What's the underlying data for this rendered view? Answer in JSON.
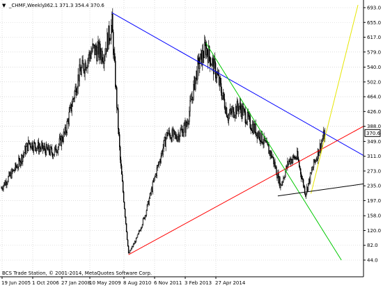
{
  "window": {
    "menu_glyph": "▼",
    "symbol_label": "_CHMF,Weekly",
    "ohlc_label": "362.1 371.3 354.4 370.6"
  },
  "copyright": "BCS Trade Station, © 2001-2014, MetaQuotes Software Corp.",
  "price_tag": "370.6",
  "colors": {
    "background": "#ffffff",
    "grid": "#c8c8c8",
    "candles": "#000000",
    "blue_line": "#0000ff",
    "red_line": "#ff0000",
    "green_line": "#00c800",
    "yellow_line": "#e6e600",
    "black_line": "#000000"
  },
  "chart_data": {
    "type": "candlestick",
    "timeframe": "Weekly",
    "symbol": "_CHMF",
    "last_bar": {
      "open": 362.1,
      "high": 371.3,
      "low": 354.4,
      "close": 370.6
    },
    "y_ticks": [
      693.0,
      655.0,
      617.0,
      579.0,
      540.0,
      502.0,
      464.0,
      426.0,
      388.0,
      349.0,
      311.0,
      273.0,
      235.0,
      197.0,
      158.0,
      120.0,
      82.0,
      44.0
    ],
    "ylim": [
      44.0,
      693.0
    ],
    "x_ticks": [
      "19 Jun 2005",
      "1 Oct 2006",
      "27 Jan 2008",
      "10 May 2009",
      "8 Aug 2010",
      "6 Nov 2011",
      "3 Feb 2013",
      "27 Apr 2014"
    ],
    "price_path": [
      {
        "x": "2005-01",
        "y": 230
      },
      {
        "x": "2005-07",
        "y": 290
      },
      {
        "x": "2005-11",
        "y": 345
      },
      {
        "x": "2006-04",
        "y": 330
      },
      {
        "x": "2006-08",
        "y": 320
      },
      {
        "x": "2006-12",
        "y": 370
      },
      {
        "x": "2007-05",
        "y": 520
      },
      {
        "x": "2007-10",
        "y": 585
      },
      {
        "x": "2008-02",
        "y": 575
      },
      {
        "x": "2008-05",
        "y": 650
      },
      {
        "x": "2008-08",
        "y": 300
      },
      {
        "x": "2008-11",
        "y": 60
      },
      {
        "x": "2009-02",
        "y": 100
      },
      {
        "x": "2009-05",
        "y": 160
      },
      {
        "x": "2009-09",
        "y": 270
      },
      {
        "x": "2010-01",
        "y": 370
      },
      {
        "x": "2010-04",
        "y": 360
      },
      {
        "x": "2010-08",
        "y": 390
      },
      {
        "x": "2010-12",
        "y": 540
      },
      {
        "x": "2011-03",
        "y": 590
      },
      {
        "x": "2011-07",
        "y": 520
      },
      {
        "x": "2011-11",
        "y": 415
      },
      {
        "x": "2012-03",
        "y": 440
      },
      {
        "x": "2012-07",
        "y": 395
      },
      {
        "x": "2012-11",
        "y": 360
      },
      {
        "x": "2013-03",
        "y": 310
      },
      {
        "x": "2013-06",
        "y": 235
      },
      {
        "x": "2013-09",
        "y": 300
      },
      {
        "x": "2013-12",
        "y": 310
      },
      {
        "x": "2014-03",
        "y": 215
      },
      {
        "x": "2014-06",
        "y": 290
      },
      {
        "x": "2014-10",
        "y": 370
      }
    ],
    "lines": [
      {
        "name": "blue",
        "color": "#0000ff",
        "points": [
          {
            "x": "2008-05",
            "y": 680
          },
          {
            "x": "2015-12",
            "y": 313
          }
        ]
      },
      {
        "name": "red",
        "color": "#ff0000",
        "points": [
          {
            "x": "2008-11",
            "y": 58
          },
          {
            "x": "2015-12",
            "y": 388
          }
        ]
      },
      {
        "name": "green",
        "color": "#00c800",
        "points": [
          {
            "x": "2011-03",
            "y": 602
          },
          {
            "x": "2015-04",
            "y": 44
          }
        ]
      },
      {
        "name": "yellow",
        "color": "#e6e600",
        "points": [
          {
            "x": "2014-05",
            "y": 215
          },
          {
            "x": "2015-10",
            "y": 700
          }
        ]
      },
      {
        "name": "black",
        "color": "#000000",
        "points": [
          {
            "x": "2013-05",
            "y": 209
          },
          {
            "x": "2015-12",
            "y": 240
          }
        ]
      }
    ],
    "grid": true
  }
}
